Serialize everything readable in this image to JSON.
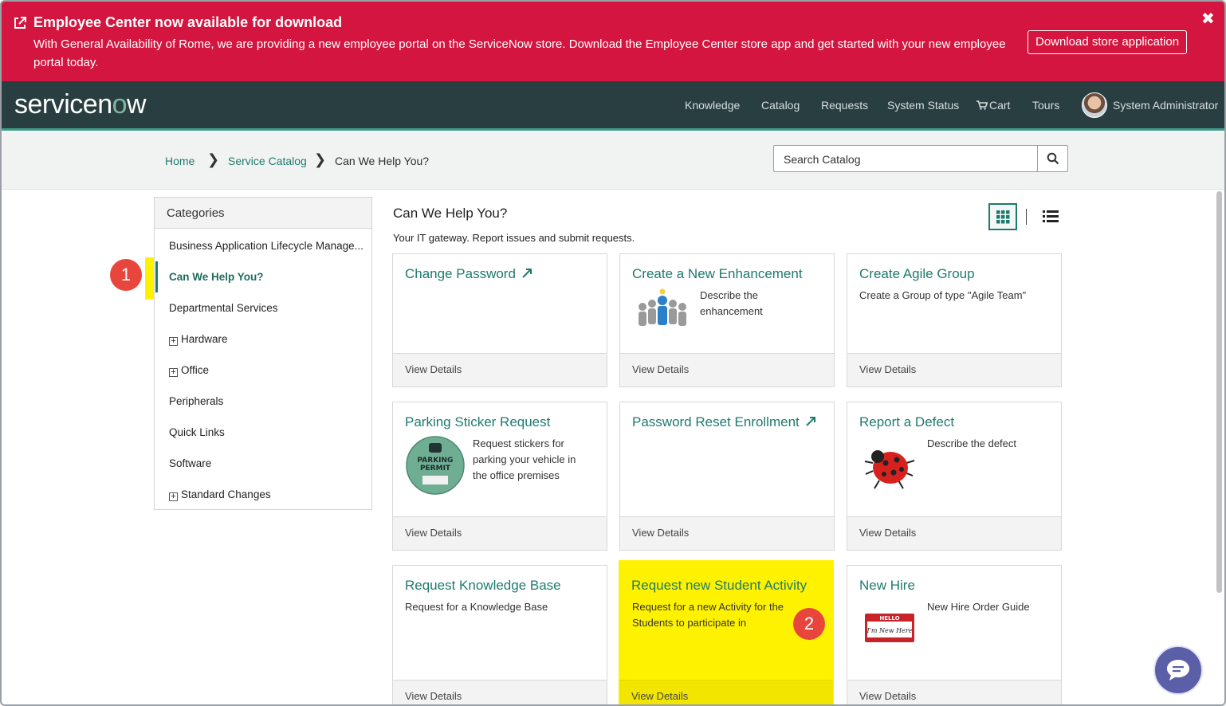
{
  "banner": {
    "title": "Employee Center now available for download",
    "text": "With General Availability of Rome, we are providing a new employee portal on the ServiceNow store. Download the Employee Center store app and get started with your new employee portal today.",
    "button": "Download store application",
    "close": "✖",
    "color": "#d4153f"
  },
  "header": {
    "logo_pre": "servicen",
    "logo_accent": "o",
    "logo_post": "w",
    "nav": [
      "Knowledge",
      "Catalog",
      "Requests",
      "System Status",
      "Cart",
      "Tours"
    ],
    "user": "System Administrator",
    "color": "#293e40"
  },
  "breadcrumb": {
    "home": "Home",
    "catalog": "Service Catalog",
    "current": "Can We Help You?",
    "sep": "❯"
  },
  "search": {
    "placeholder": "Search Catalog"
  },
  "categories": {
    "heading": "Categories",
    "items": [
      "Business Application Lifecycle Manage...",
      "Can We Help You?",
      "Departmental Services",
      "Hardware",
      "Office",
      "Peripherals",
      "Quick Links",
      "Software",
      "Standard Changes"
    ],
    "plus": "+"
  },
  "badges": {
    "one": "1",
    "two": "2"
  },
  "main": {
    "title": "Can We Help You?",
    "subtitle": "Your IT gateway. Report issues and submit requests."
  },
  "cards": [
    {
      "title": "Change Password",
      "desc": "",
      "footer": "View Details"
    },
    {
      "title": "Create a New Enhancement",
      "desc": "Describe the enhancement",
      "footer": "View Details"
    },
    {
      "title": "Create Agile Group",
      "desc": "Create a Group of type \"Agile Team\"",
      "footer": "View Details"
    },
    {
      "title": "Parking Sticker Request",
      "desc": "Request stickers for parking your vehicle in the office premises",
      "footer": "View Details"
    },
    {
      "title": "Password Reset Enrollment",
      "desc": "",
      "footer": "View Details"
    },
    {
      "title": "Report a Defect",
      "desc": "Describe the defect",
      "footer": "View Details"
    },
    {
      "title": "Request Knowledge Base",
      "desc": "Request for a Knowledge Base",
      "footer": "View Details"
    },
    {
      "title": "Request new Student Activity",
      "desc": "Request for a new Activity for the Students to participate in",
      "footer": "View Details"
    },
    {
      "title": "New Hire",
      "desc": "New Hire Order Guide",
      "footer": "View Details"
    }
  ],
  "images": {
    "parking_l1": "PARKING",
    "parking_l2": "PERMIT",
    "hello": "HELLO",
    "new_here": "I'm New Here"
  },
  "icons": [
    "external-link-icon",
    "search-icon",
    "cart-icon",
    "grid-view-icon",
    "list-view-icon",
    "chat-icon",
    "link-arrow-icon"
  ],
  "accent": "#1f7a6e",
  "highlight": "#fff200"
}
